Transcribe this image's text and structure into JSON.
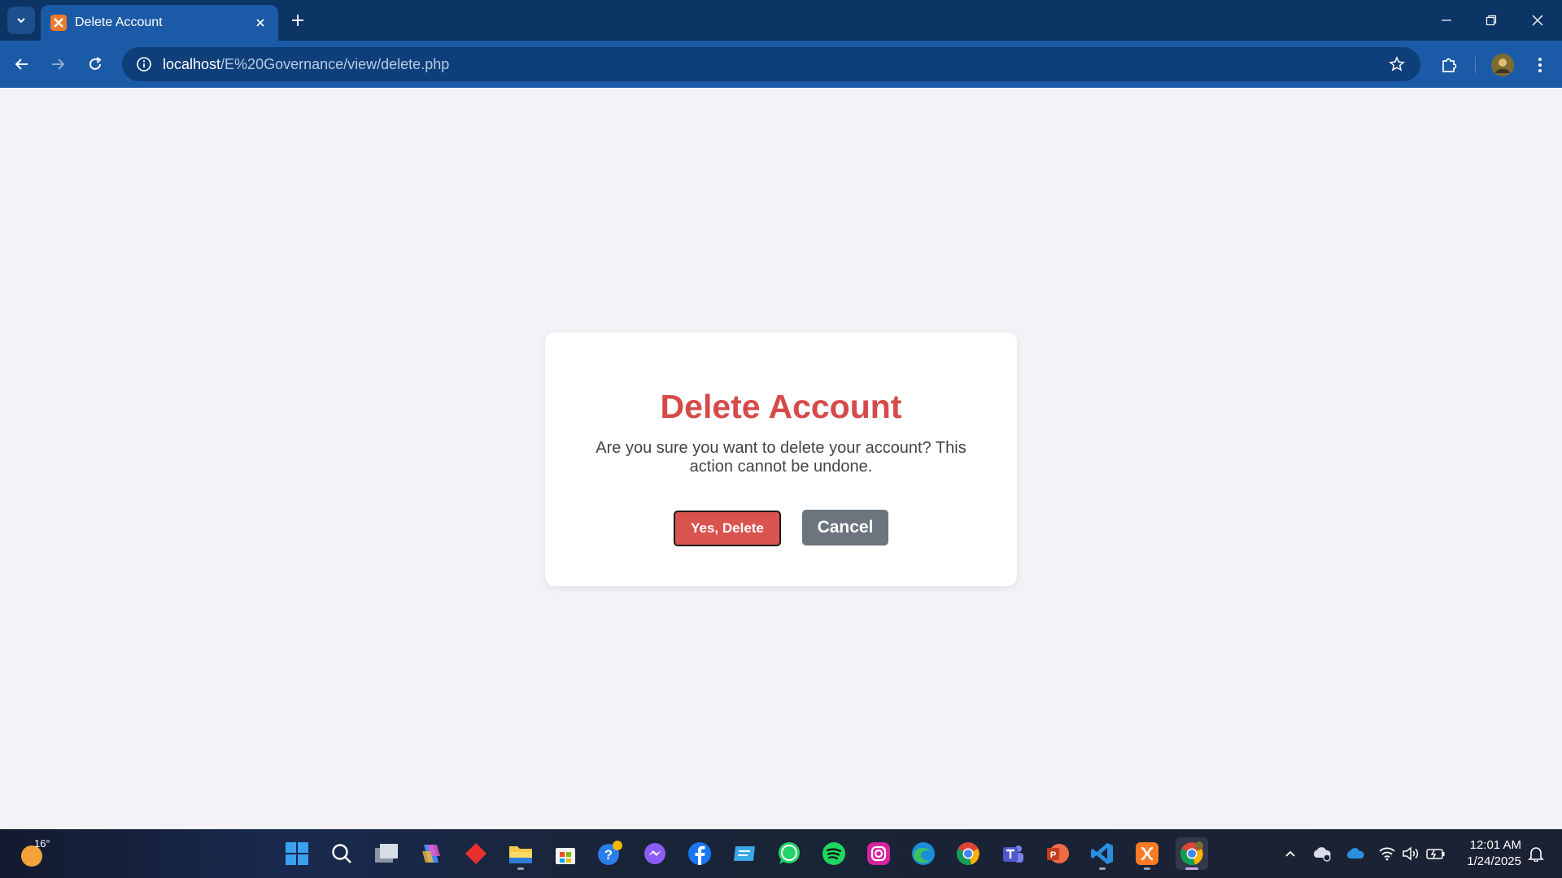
{
  "browser": {
    "tab": {
      "title": "Delete Account",
      "favicon": "xampp-icon"
    },
    "url": {
      "host": "localhost",
      "path": "/E%20Governance/view/delete.php"
    },
    "colors": {
      "tabstrip": "#0c3464",
      "toolbar": "#1b5aa6"
    }
  },
  "dialog": {
    "title": "Delete Account",
    "message": "Are you sure you want to delete your account? This action cannot be undone.",
    "confirm_label": "Yes, Delete",
    "cancel_label": "Cancel",
    "colors": {
      "title": "#d64a4a",
      "confirm": "#d9534f",
      "cancel": "#6c757d"
    }
  },
  "taskbar": {
    "weather_temp": "16°",
    "apps": [
      "windows-start",
      "search",
      "task-view",
      "copilot",
      "app-red",
      "file-explorer",
      "microsoft-store",
      "help",
      "messenger",
      "facebook",
      "app-blue",
      "whatsapp",
      "spotify",
      "instagram",
      "edge",
      "chrome",
      "teams",
      "powerpoint",
      "vscode",
      "xampp",
      "chrome-active"
    ],
    "clock": {
      "time": "12:01 AM",
      "date": "1/24/2025"
    }
  }
}
